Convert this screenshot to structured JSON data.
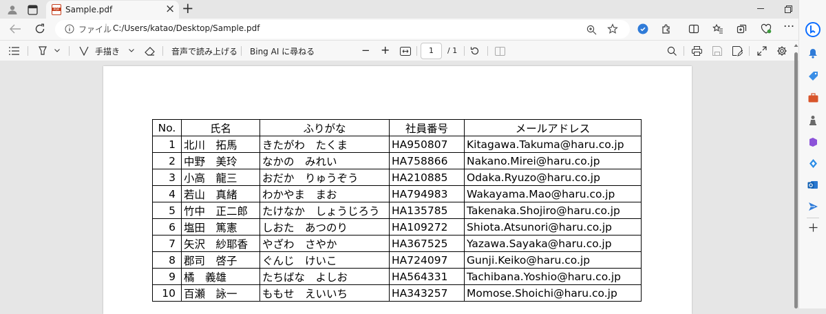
{
  "tab": {
    "title": "Sample.pdf",
    "favicon": "pdf-icon",
    "close": "×",
    "new_tab": "+"
  },
  "address_bar": {
    "scheme_label": "ファイル",
    "url": "C:/Users/katao/Desktop/Sample.pdf"
  },
  "pdf_toolbar": {
    "draw_label": "手描き",
    "read_aloud_label": "音声で読み上げる",
    "bing_label": "Bing AI に尋ねる",
    "zoom_out": "−",
    "zoom_in": "+",
    "current_page": "1",
    "page_total": "/ 1"
  },
  "table": {
    "headers": [
      "No.",
      "氏名",
      "ふりがな",
      "社員番号",
      "メールアドレス"
    ],
    "rows": [
      [
        "1",
        "北川　拓馬",
        "きたがわ　たくま",
        "HA950807",
        "Kitagawa.Takuma@haru.co.jp"
      ],
      [
        "2",
        "中野　美玲",
        "なかの　みれい",
        "HA758866",
        "Nakano.Mirei@haru.co.jp"
      ],
      [
        "3",
        "小高　龍三",
        "おだか　りゅうぞう",
        "HA210885",
        "Odaka.Ryuzo@haru.co.jp"
      ],
      [
        "4",
        "若山　真緒",
        "わかやま　まお",
        "HA794983",
        "Wakayama.Mao@haru.co.jp"
      ],
      [
        "5",
        "竹中　正二郎",
        "たけなか　しょうじろう",
        "HA135785",
        "Takenaka.Shojiro@haru.co.jp"
      ],
      [
        "6",
        "塩田　篤憲",
        "しおた　あつのり",
        "HA109272",
        "Shiota.Atsunori@haru.co.jp"
      ],
      [
        "7",
        "矢沢　紗耶香",
        "やざわ　さやか",
        "HA367525",
        "Yazawa.Sayaka@haru.co.jp"
      ],
      [
        "8",
        "郡司　啓子",
        "ぐんじ　けいこ",
        "HA724097",
        "Gunji.Keiko@haru.co.jp"
      ],
      [
        "9",
        "橘　義雄",
        "たちばな　よしお",
        "HA564331",
        "Tachibana.Yoshio@haru.co.jp"
      ],
      [
        "10",
        "百瀬　詠一",
        "ももせ　えいいち",
        "HA343257",
        "Momose.Shoichi@haru.co.jp"
      ]
    ]
  },
  "colors": {
    "browser_chrome": "#f7f7f7",
    "tab_strip": "#e6e6e6",
    "edge_accent": "#0b6cff"
  },
  "sidebar_icons": [
    "bell-icon",
    "tag-icon",
    "briefcase-icon",
    "chess-icon",
    "copilot-icon",
    "outlook-icon",
    "send-icon",
    "add-icon"
  ]
}
